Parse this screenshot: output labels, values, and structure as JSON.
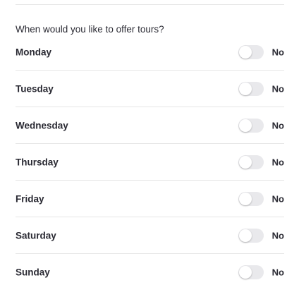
{
  "question": "When would you like to offer tours?",
  "days": [
    {
      "label": "Monday",
      "enabled": false,
      "state_label": "No"
    },
    {
      "label": "Tuesday",
      "enabled": false,
      "state_label": "No"
    },
    {
      "label": "Wednesday",
      "enabled": false,
      "state_label": "No"
    },
    {
      "label": "Thursday",
      "enabled": false,
      "state_label": "No"
    },
    {
      "label": "Friday",
      "enabled": false,
      "state_label": "No"
    },
    {
      "label": "Saturday",
      "enabled": false,
      "state_label": "No"
    },
    {
      "label": "Sunday",
      "enabled": false,
      "state_label": "No"
    }
  ]
}
